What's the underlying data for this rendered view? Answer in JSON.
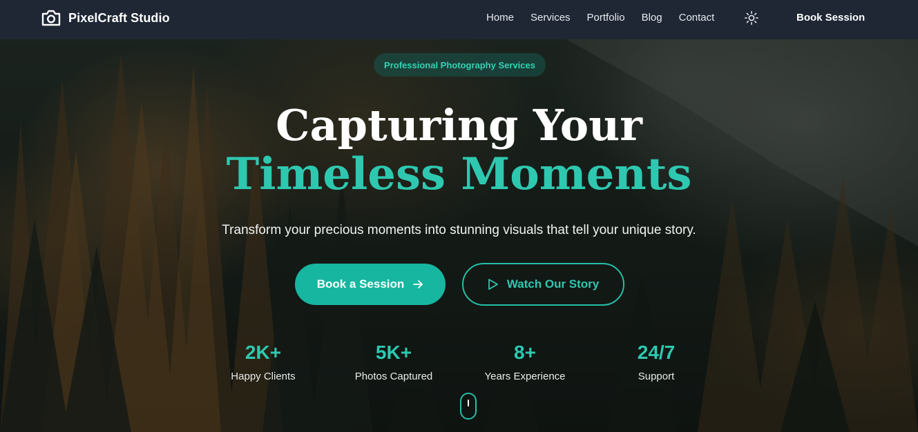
{
  "navbar": {
    "brand_name": "PixelCraft Studio",
    "brand_icon": "camera-icon",
    "links": [
      "Home",
      "Services",
      "Portfolio",
      "Blog",
      "Contact"
    ],
    "theme_toggle_icon": "sun-icon",
    "book_label": "Book Session"
  },
  "hero": {
    "badge": "Professional Photography Services",
    "headline_line1": "Capturing Your",
    "headline_line2": "Timeless Moments",
    "subtitle": "Transform your precious moments into stunning visuals that tell your unique story.",
    "primary_button": {
      "label": "Book a Session",
      "icon": "arrow-right-icon"
    },
    "secondary_button": {
      "label": "Watch Our Story",
      "icon": "play-icon"
    },
    "stats": [
      {
        "value": "2K+",
        "label": "Happy Clients"
      },
      {
        "value": "5K+",
        "label": "Photos Captured"
      },
      {
        "value": "8+",
        "label": "Years Experience"
      },
      {
        "value": "24/7",
        "label": "Support"
      }
    ],
    "scroll_icon": "mouse-scroll-icon"
  },
  "colors": {
    "accent": "#2ec8b0",
    "primary_button": "#17b6a0",
    "navbar_bg": "#1f2735"
  }
}
